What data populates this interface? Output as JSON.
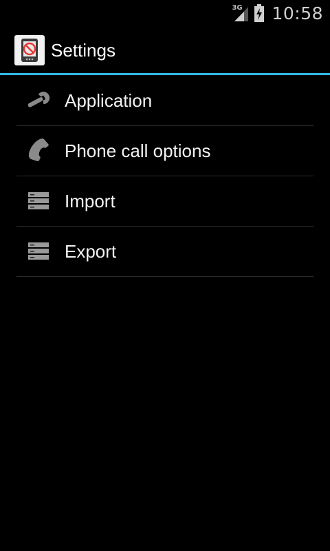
{
  "status_bar": {
    "network_type": "3G",
    "time": "10:58",
    "icons": [
      "signal-icon",
      "battery-charging-icon"
    ]
  },
  "action_bar": {
    "title": "Settings",
    "app_icon": "no-phone-app-icon",
    "accent_color": "#33b5e5"
  },
  "settings_list": [
    {
      "label": "Application",
      "icon": "wrench-icon"
    },
    {
      "label": "Phone call options",
      "icon": "phone-handset-icon"
    },
    {
      "label": "Import",
      "icon": "storage-list-icon"
    },
    {
      "label": "Export",
      "icon": "storage-list-icon"
    }
  ]
}
